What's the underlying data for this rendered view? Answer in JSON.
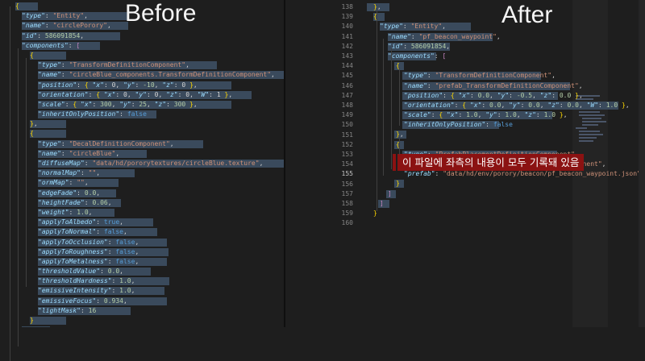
{
  "headings": {
    "before": "Before",
    "after": "After"
  },
  "annotation": "이 파일에 좌측의 내용이 모두 기록돼 있음",
  "before": {
    "lines": [
      "{",
      "\"type\": \"Entity\",",
      "\"name\": \"circlePorory\",",
      "\"id\": 586091854,",
      "\"components\": [",
      "{",
      "\"type\": \"TransformDefinitionComponent\",",
      "\"name\": \"circleBlue_components.TransformDefinitionComponent\",",
      "\"position\": { \"x\": 0, \"y\": -10, \"z\": 0 },",
      "\"orientation\": { \"x\": 0, \"y\": 0, \"z\": 0, \"W\": 1 },",
      "\"scale\": { \"x\": 300, \"y\": 25, \"z\": 300 },",
      "\"inheritOnlyPosition\": false",
      "},",
      "{",
      "\"type\": \"DecalDefinitionComponent\",",
      "\"name\": \"circleBlue\",",
      "\"diffuseMap\": \"data/hd/pororytextures/circleBlue.texture\",",
      "\"normalMap\": \"\",",
      "\"ormMap\": \"\",",
      "\"edgeFade\": 0.0,",
      "\"heightFade\": 0.06,",
      "\"weight\": 1.0,",
      "\"applyToAlbedo\": true,",
      "\"applyToNormal\": false,",
      "\"applyToOcclusion\": false,",
      "\"applyToRoughness\": false,",
      "\"applyToMetalness\": false,",
      "\"thresholdValue\": 0.0,",
      "\"thresholdHardness\": 1.0,",
      "\"emissiveIntensity\": 1.0,",
      "\"emissiveFocus\": 0.934,",
      "\"lightMask\": 16",
      "}",
      "]",
      "]",
      "}"
    ]
  },
  "after": {
    "line_numbers": [
      "138",
      "139",
      "140",
      "141",
      "142",
      "143",
      "144",
      "145",
      "146",
      "147",
      "148",
      "149",
      "150",
      "151",
      "152",
      "153",
      "154",
      "155",
      "156",
      "157",
      "158",
      "159",
      "160"
    ],
    "lines": [
      "},",
      "{",
      "\"type\": \"Entity\",",
      "\"name\": \"pf_beacon_waypoint\",",
      "\"id\": 586091854,",
      "\"components\": [",
      "{",
      "\"type\": \"TransformDefinitionComponent\",",
      "\"name\": \"prefab_TransformDefinitionComponent\",",
      "\"position\": { \"x\": 0.0, \"y\": -0.5, \"z\": 0.0 },",
      "\"orientation\": { \"x\": 0.0, \"y\": 0.0, \"z\": 0.0, \"W\": 1.0 },",
      "\"scale\": { \"x\": 1.0, \"y\": 1.0, \"z\": 1.0 },",
      "\"inheritOnlyPosition\": false",
      "},",
      "{",
      "\"type\": \"PrefabPlacementDefinitionComponent\",",
      "\"name\": \"prefab_PrefabPlacementDefinitionComponent\",",
      "\"prefab\": \"data/hd/env/porory/beacon/pf_beacon_waypoint.json\"",
      "}",
      "]",
      "]",
      "}",
      ""
    ]
  },
  "colors": {
    "key": "#9cdcfe",
    "string": "#ce9178",
    "number": "#b5cea8",
    "keyword": "#569cd6",
    "highlight": "#8b1212"
  }
}
